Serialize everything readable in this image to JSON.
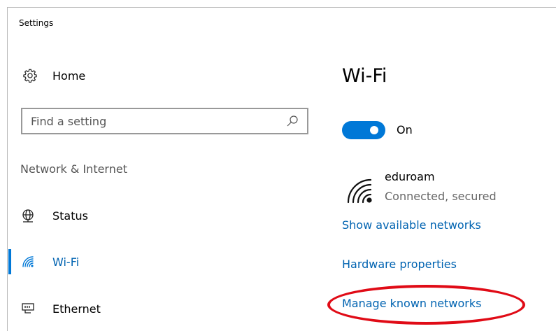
{
  "window": {
    "title": "Settings"
  },
  "sidebar": {
    "home_label": "Home",
    "search": {
      "placeholder": "Find a setting",
      "value": ""
    },
    "section_header": "Network & Internet",
    "items": [
      {
        "label": "Status",
        "icon": "globe-icon",
        "selected": false
      },
      {
        "label": "Wi-Fi",
        "icon": "wifi-icon",
        "selected": true
      },
      {
        "label": "Ethernet",
        "icon": "ethernet-icon",
        "selected": false
      }
    ]
  },
  "main": {
    "title": "Wi-Fi",
    "toggle": {
      "state_label": "On",
      "on": true
    },
    "network": {
      "ssid": "eduroam",
      "status": "Connected, secured"
    },
    "links": {
      "show_available": "Show available networks",
      "hardware_properties": "Hardware properties",
      "manage_known": "Manage known networks"
    }
  },
  "colors": {
    "accent": "#0078d7",
    "link": "#0063b1",
    "annotation": "#e00b16"
  }
}
